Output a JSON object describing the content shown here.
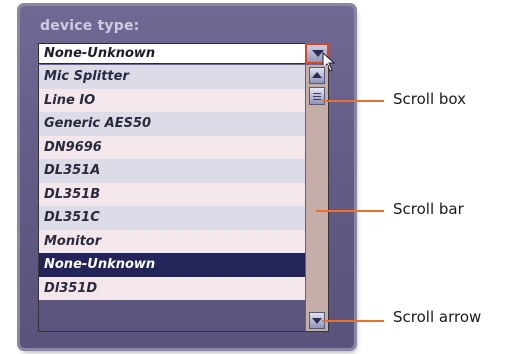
{
  "panel": {
    "label": "device type:"
  },
  "select": {
    "value": "None-Unknown"
  },
  "list": {
    "items": [
      {
        "label": "Mic Splitter"
      },
      {
        "label": "Line IO"
      },
      {
        "label": "Generic AES50"
      },
      {
        "label": "DN9696"
      },
      {
        "label": "DL351A"
      },
      {
        "label": "DL351B"
      },
      {
        "label": "DL351C"
      },
      {
        "label": "Monitor"
      },
      {
        "label": "None-Unknown",
        "selected": true
      },
      {
        "label": "Dl351D"
      }
    ]
  },
  "callouts": {
    "scroll_box": "Scroll box",
    "scroll_bar": "Scroll bar",
    "scroll_arrow": "Scroll arrow"
  },
  "colors": {
    "panel": "#625c86",
    "selected_row": "#22245a",
    "callout_line": "#e8722a",
    "scrollbar_track": "#c5aea8"
  }
}
